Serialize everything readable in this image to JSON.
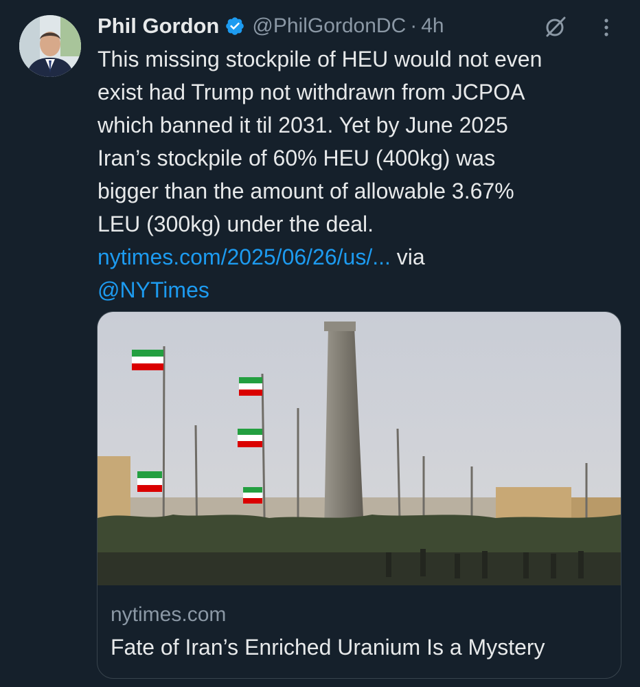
{
  "tweet": {
    "author_name": "Phil Gordon",
    "handle": "@PhilGordonDC",
    "separator": "·",
    "time": "4h",
    "text_lines": [
      "This missing stockpile of HEU would not even",
      "exist had Trump not withdrawn from JCPOA",
      "which banned it til 2031. Yet by June 2025",
      "Iran’s stockpile of 60% HEU (400kg) was",
      "bigger than the amount of allowable 3.67%",
      "LEU (300kg) under the deal."
    ],
    "link_text": "nytimes.com/2025/06/26/us/...",
    "via_text": " via",
    "mention": "@NYTimes"
  },
  "card": {
    "domain": "nytimes.com",
    "title": "Fate of Iran’s Enriched Uranium Is a Mystery"
  },
  "icons": {
    "verified": "verified-badge-icon",
    "grok": "grok-icon",
    "more": "more-options-icon"
  },
  "colors": {
    "background": "#15202b",
    "text": "#e7e9ea",
    "secondary": "#8b98a5",
    "link": "#1d9bf0",
    "verified": "#1d9bf0",
    "card_border": "#38444d"
  }
}
